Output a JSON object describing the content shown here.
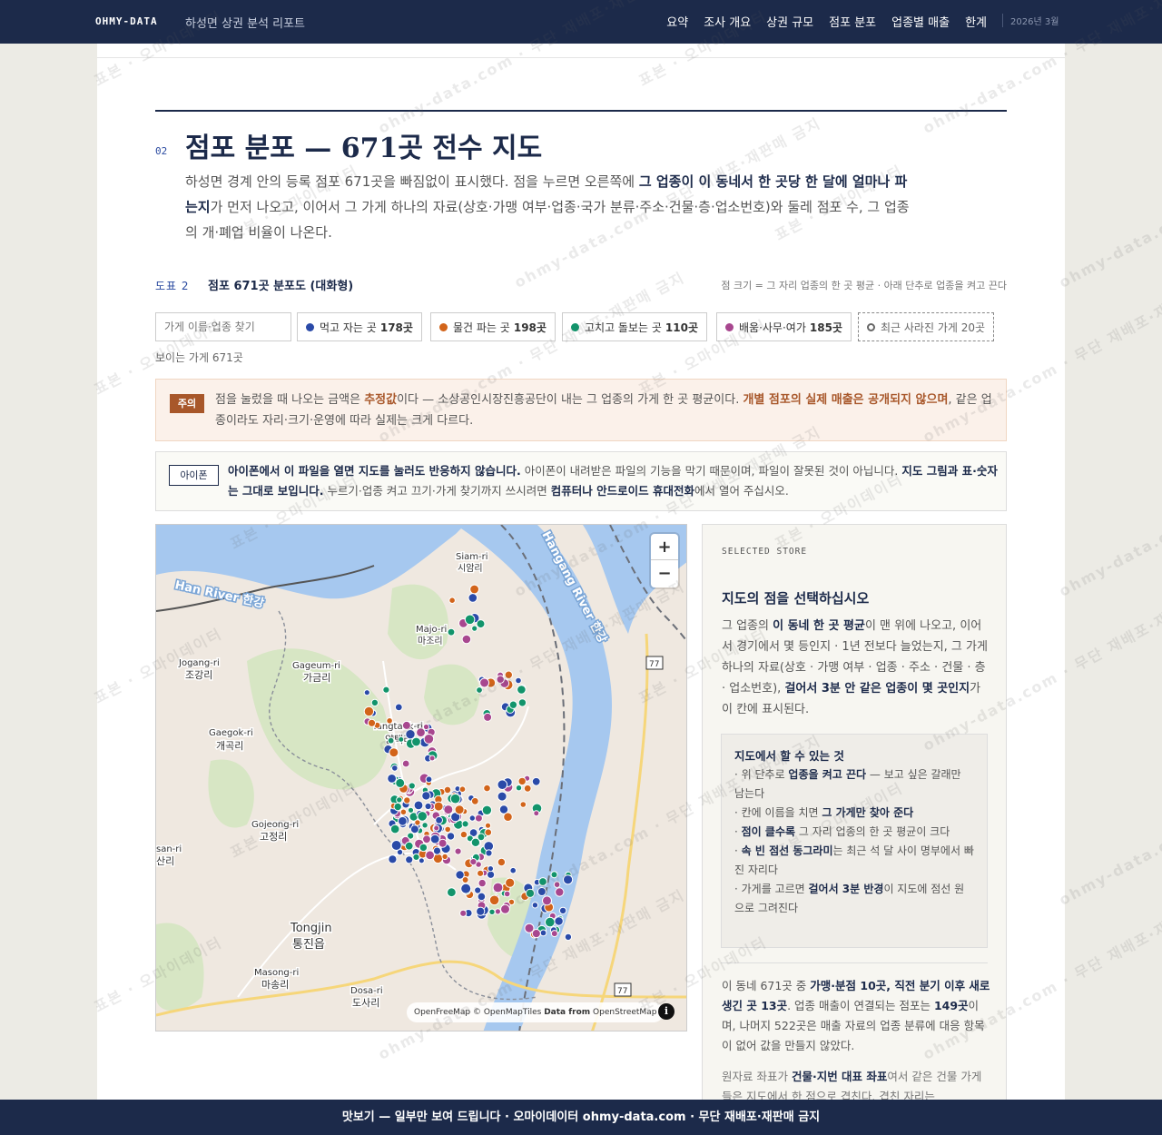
{
  "topbar": {
    "brand": "OHMY-DATA",
    "report_title": "하성면 상권 분석 리포트",
    "nav": [
      "요약",
      "조사 개요",
      "상권 규모",
      "점포 분포",
      "업종별 매출",
      "한계"
    ],
    "date": "2026년 3월"
  },
  "section": {
    "number": "02",
    "title": "점포 분포 — 671곳 전수 지도",
    "intro_a": "하성면 경계 안의 등록 점포 671곳을 빠짐없이 표시했다. 점을 누르면 오른쪽에 ",
    "intro_b": "그 업종이 이 동네서 한 곳당 한 달에 얼마나 파는지",
    "intro_c": "가 먼저 나오고, 이어서 그 가게 하나의 자료(상호·가맹 여부·업종·국가 분류·주소·건물·층·업소번호)와 둘레 점포 수, 그 업종의 개·폐업 비율이 나온다."
  },
  "figure": {
    "label": "도표 2",
    "title": "점포 671곳 분포도 (대화형)",
    "note": "점 크기 = 그 자리 업종의 한 곳 평균 · 아래 단추로 업종을 켜고 끈다"
  },
  "filters": {
    "search_placeholder": "가게 이름·업종 찾기",
    "chips": [
      {
        "label": "먹고 자는 곳",
        "count": "178곳",
        "color": "#2a4aa8"
      },
      {
        "label": "물건 파는 곳",
        "count": "198곳",
        "color": "#d2641a"
      },
      {
        "label": "고치고 돌보는 곳",
        "count": "110곳",
        "color": "#12946b"
      },
      {
        "label": "배움·사무·여가",
        "count": "185곳",
        "color": "#a8478f"
      }
    ],
    "closed_chip": "최근 사라진 가게 20곳",
    "visible_count": "보이는 가게 671곳"
  },
  "caution": {
    "tag": "주의",
    "text_a": "점을 눌렀을 때 나오는 금액은 ",
    "text_b": "추정값",
    "text_c": "이다 — 소상공인시장진흥공단이 내는 그 업종의 가게 한 곳 평균이다. ",
    "text_d": "개별 점포의 실제 매출은 공개되지 않으며",
    "text_e": ", 같은 업종이라도 자리·크기·운영에 따라 실제는 크게 다르다."
  },
  "iphone": {
    "tag": "아이폰",
    "text_a": "아이폰에서 이 파일을 열면 지도를 눌러도 반응하지 않습니다.",
    "text_b": " 아이폰이 내려받은 파일의 기능을 막기 때문이며, 파일이 잘못된 것이 아닙니다. ",
    "text_c": "지도 그림과 표·숫자는 그대로 보입니다.",
    "text_d": " 누르기·업종 켜고 끄기·가게 찾기까지 쓰시려면 ",
    "text_e": "컴퓨터나 안드로이드 휴대전화",
    "text_f": "에서 열어 주십시오."
  },
  "map": {
    "zoom_in": "+",
    "zoom_out": "−",
    "attribution_a": "OpenFreeMap © OpenMapTiles ",
    "attribution_b": "Data from",
    "attribution_c": " OpenStreetMap",
    "info": "i",
    "labels": {
      "han_river": "Han River 한강",
      "hangang_river": "Hangang River 한강",
      "siam": "Siam-ri",
      "siam_ko": "시암리",
      "majo": "Majo-ri",
      "majo_ko": "마조리",
      "jogang": "Jogang-ri",
      "jogang_ko": "조강리",
      "gageum": "Gageum-ri",
      "gageum_ko": "가금리",
      "gaegok": "Gaegok-ri",
      "gaegok_ko": "개곡리",
      "yangtaek": "Yangtaek-ri",
      "yangtaek_ko": "양택리",
      "gojeong": "Gojeong-ri",
      "gojeong_ko": "고정리",
      "san": "san-ri",
      "san_ko": "산리",
      "tongjin": "Tongjin",
      "tongjin_ko": "통진읍",
      "masong": "Masong-ri",
      "masong_ko": "마송리",
      "dosa": "Dosa-ri",
      "dosa_ko": "도사리",
      "road_77": "77"
    }
  },
  "panel": {
    "kicker": "SELECTED STORE",
    "title": "지도의 점을 선택하십시오",
    "desc_a": "그 업종의 ",
    "desc_b": "이 동네 한 곳 평균",
    "desc_c": "이 맨 위에 나오고, 이어서 경기에서 몇 등인지 · 1년 전보다 늘었는지, 그 가게 하나의 자료(상호 · 가맹 여부 · 업종 · 주소 · 건물 · 층 · 업소번호), ",
    "desc_d": "걸어서 3분 안 같은 업종이 몇 곳인지",
    "desc_e": "가 이 칸에 표시된다.",
    "howto_title": "지도에서 할 수 있는 것",
    "howto_1a": "· 위 단추로 ",
    "howto_1b": "업종을 켜고 끈다",
    "howto_1c": " — 보고 싶은 갈래만 남는다",
    "howto_2a": "· 칸에 이름을 치면 ",
    "howto_2b": "그 가게만 찾아 준다",
    "howto_3a": "· ",
    "howto_3b": "점이 클수록",
    "howto_3c": " 그 자리 업종의 한 곳 평균이 크다",
    "howto_4a": "· ",
    "howto_4b": "속 빈 점선 동그라미",
    "howto_4c": "는 최근 석 달 사이 명부에서 빠진 자리다",
    "howto_5a": "· 가게를 고르면 ",
    "howto_5b": "걸어서 3분 반경",
    "howto_5c": "이 지도에 점선 원으로 그려진다",
    "stats_a": "이 동네 671곳 중 ",
    "stats_b": "가맹·분점 10곳",
    "stats_c": ", ",
    "stats_d": "직전 분기 이후 새로 생긴 곳 13곳",
    "stats_e": ". 업종 매출이 연결되는 점포는 ",
    "stats_f": "149곳",
    "stats_g": "이며, 나머지 522곳은 매출 자료의 업종 분류에 대응 항목이 없어 값을 만들지 않았다.",
    "more_a": "원자료 좌표가 ",
    "more_b": "건물·지번 대표 좌표",
    "more_c": "여서 같은 건물 가게들은 지도에서 한 점으로 겹친다. 겹친 자리는"
  },
  "footer": {
    "text": "맛보기 — 일부만 보여 드립니다 · 오마이데이터 ohmy-data.com · 무단 재배포·재판매 금지"
  },
  "watermark": {
    "a": "표본 · 오마이데이터",
    "b": "ohmy-data.com · 무단 재배포·재판매 금지"
  }
}
